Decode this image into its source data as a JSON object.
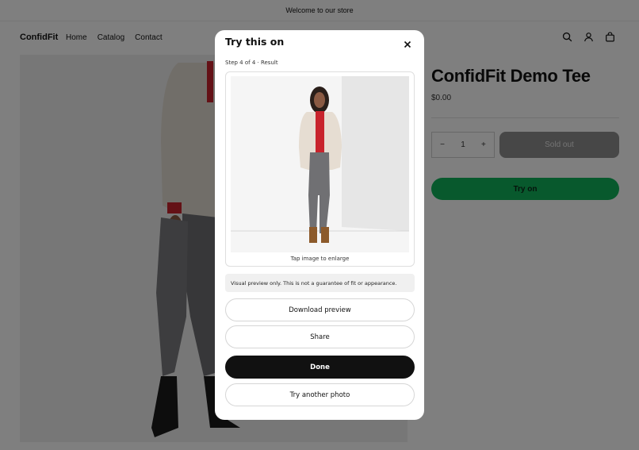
{
  "announcement": "Welcome to our store",
  "header": {
    "logo": "ConfidFit",
    "nav": [
      "Home",
      "Catalog",
      "Contact"
    ],
    "icons": [
      "search-icon",
      "account-icon",
      "cart-icon"
    ]
  },
  "product": {
    "title": "ConfidFit Demo Tee",
    "price": "$0.00",
    "quantity": "1",
    "decrease_symbol": "−",
    "increase_symbol": "+",
    "sold_out_label": "Sold out",
    "try_on_label": "Try on"
  },
  "modal": {
    "title": "Try this on",
    "step": "Step 4 of 4 · Result",
    "enlarge_hint": "Tap image to enlarge",
    "notice": "Visual preview only. This is not a guarantee of fit or appearance.",
    "buttons": {
      "download": "Download preview",
      "share": "Share",
      "done": "Done",
      "another": "Try another photo"
    }
  },
  "colors": {
    "overlay": "rgba(0,0,0,0.5)",
    "try_on_green": "#10b25a",
    "done_black": "#111111",
    "sold_out_gray": "#8f8f8f"
  }
}
